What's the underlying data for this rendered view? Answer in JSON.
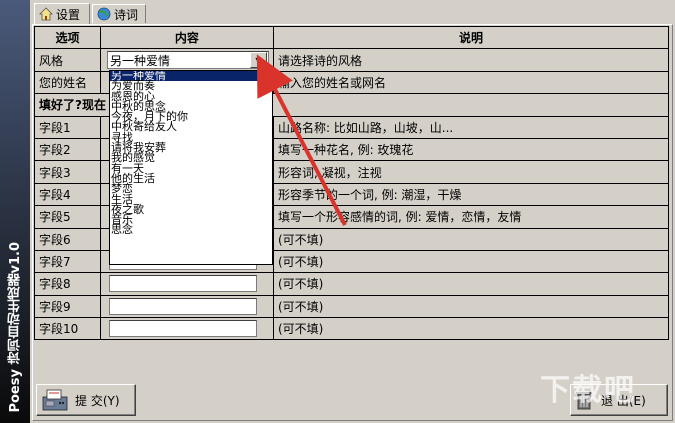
{
  "app": {
    "sidebar_title": "Poesy 诗词自动生成器v1.0",
    "tabs": [
      {
        "label": "设置",
        "icon": "house-icon",
        "active": true
      },
      {
        "label": "诗词",
        "icon": "globe-icon",
        "active": false
      }
    ]
  },
  "table": {
    "headers": [
      "选项",
      "内容",
      "说明"
    ],
    "style_row": {
      "label": "风格",
      "value": "另一种爱情",
      "desc": "请选择诗的风格"
    },
    "name_row": {
      "label": "您的姓名",
      "desc": "输入您的姓名或网名"
    },
    "section_heading": "填好了?现在",
    "fields": [
      {
        "label": "字段1",
        "desc": "山路名称: 比如山路，山坡，山..."
      },
      {
        "label": "字段2",
        "desc": "填写一种花名, 例: 玫瑰花"
      },
      {
        "label": "字段3",
        "desc": "形容词, 凝视，注视"
      },
      {
        "label": "字段4",
        "desc": "形容季节的一个词, 例: 潮湿，干燥"
      },
      {
        "label": "字段5",
        "desc": "填写一个形容感情的词, 例: 爱情，恋情，友情"
      },
      {
        "label": "字段6",
        "desc": "(可不填)"
      },
      {
        "label": "字段7",
        "desc": "(可不填)"
      },
      {
        "label": "字段8",
        "desc": "(可不填)"
      },
      {
        "label": "字段9",
        "desc": "(可不填)"
      },
      {
        "label": "字段10",
        "desc": "(可不填)"
      }
    ]
  },
  "dropdown": {
    "selected_index": 0,
    "options": [
      "另一种爱情",
      "为爱而奏",
      "感恩的心",
      "中秋的思念",
      "今夜，月下的你",
      "中秋寄给友人",
      "寻找",
      "请将我安葬",
      "我的感觉",
      "有一天",
      "他的生活",
      "梦恋",
      "生活",
      "夜之歌",
      "音乐",
      "思念"
    ]
  },
  "buttons": {
    "submit": "提 交(Y)",
    "exit": "退 出(E)"
  },
  "watermark": "下载吧",
  "colors": {
    "highlight": "#0a246a",
    "arrow": "#d9332b"
  }
}
